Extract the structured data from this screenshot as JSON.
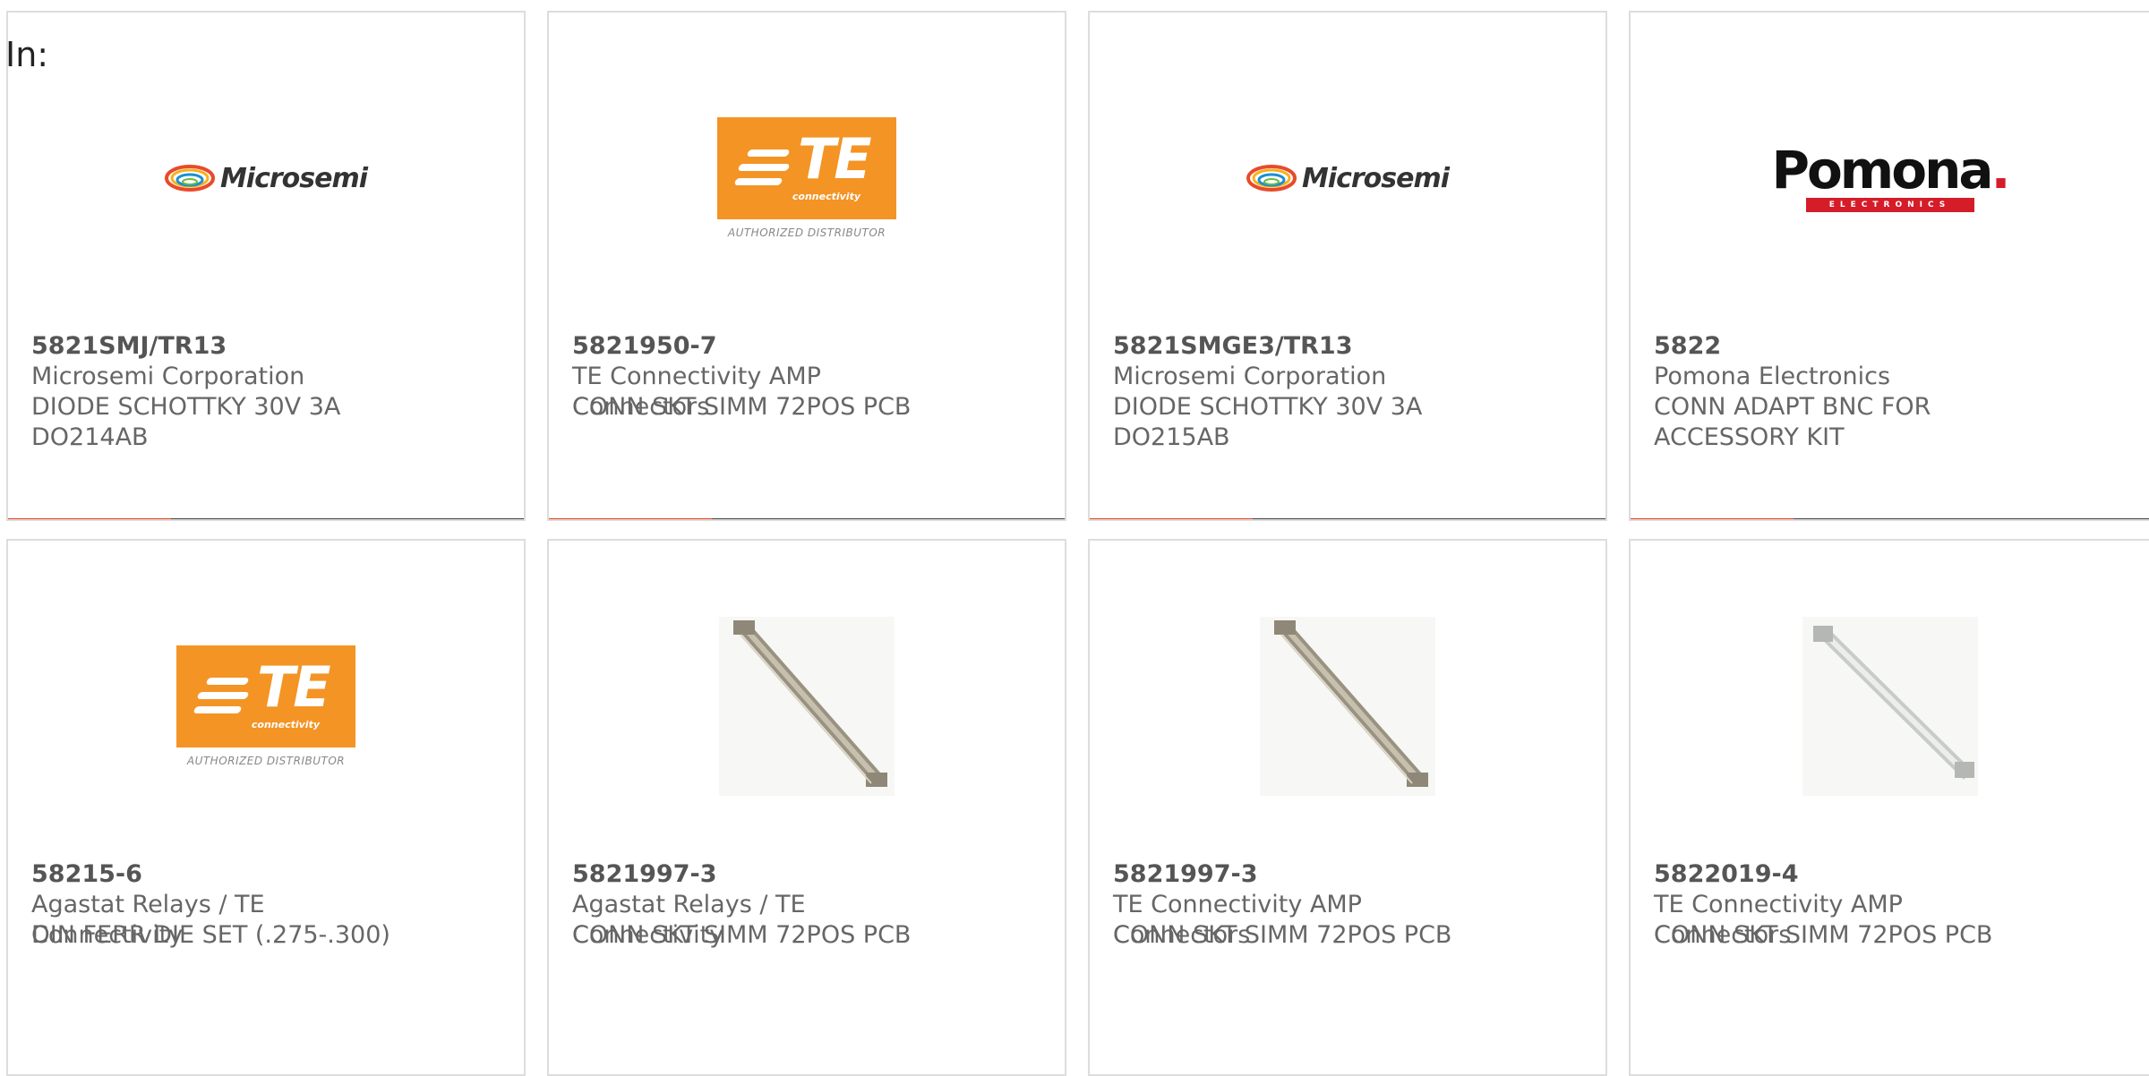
{
  "filter_label": "In:",
  "logo_text": {
    "microsemi": "Microsemi",
    "te_word": "TE",
    "te_sub": "connectivity",
    "te_caption": "AUTHORIZED DISTRIBUTOR",
    "pomona": "Pomona",
    "pomona_sub": "ELECTRONICS"
  },
  "colors": {
    "accent_bar": "#e8431a",
    "bar_dark": "#444444",
    "te_orange": "#f39425",
    "pomona_red": "#d51c29"
  },
  "products": [
    {
      "part": "5821SMJ/TR13",
      "manufacturer": "Microsemi Corporation",
      "description": "DIODE SCHOTTKY 30V 3A DO214AB",
      "image": "microsemi-logo"
    },
    {
      "part": "5821950-7",
      "manufacturer": "TE Connectivity AMP Connectors",
      "description": "CONN SKT SIMM 72POS PCB",
      "image": "te-connectivity-logo"
    },
    {
      "part": "5821SMGE3/TR13",
      "manufacturer": "Microsemi Corporation",
      "description": "DIODE SCHOTTKY 30V 3A DO215AB",
      "image": "microsemi-logo"
    },
    {
      "part": "5822",
      "manufacturer": "Pomona Electronics",
      "description": "CONN ADAPT BNC FOR ACCESSORY KIT",
      "image": "pomona-logo"
    },
    {
      "part": "58215-6",
      "manufacturer": "Agastat Relays / TE Connectivity",
      "description": "DIN FERR DIE SET (.275-.300)",
      "image": "te-connectivity-logo"
    },
    {
      "part": "5821997-3",
      "manufacturer": "Agastat Relays / TE Connectivity",
      "description": "CONN SKT SIMM 72POS PCB",
      "image": "simm-socket-photo"
    },
    {
      "part": "5821997-3",
      "manufacturer": "TE Connectivity AMP Connectors",
      "description": "CONN SKT SIMM 72POS PCB",
      "image": "simm-socket-photo"
    },
    {
      "part": "5822019-4",
      "manufacturer": "TE Connectivity AMP Connectors",
      "description": "CONN SKT SIMM 72POS PCB",
      "image": "simm-socket-photo-light"
    }
  ]
}
